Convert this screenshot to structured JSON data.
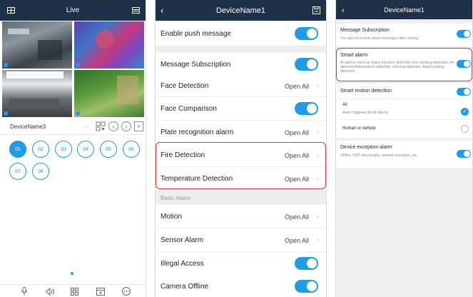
{
  "screen1": {
    "title": "Live",
    "device_name": "DeviceName3",
    "channels": [
      "01",
      "02",
      "03",
      "04",
      "05",
      "06",
      "07",
      "08"
    ],
    "selected_channel": "01"
  },
  "screen2": {
    "title": "DeviceName1",
    "enable_push": "Enable push message",
    "message_subscription": "Message Subscription",
    "face_detection": "Face Detection",
    "face_comparison": "Face Comparison",
    "plate_recognition": "Plate recognition alarm",
    "fire_detection": "Fire Detection",
    "temperature_detection": "Temperature Detection",
    "basic_alarm_header": "Basic Alarm",
    "motion": "Motion",
    "sensor_alarm": "Sensor Alarm",
    "illegal_access": "Illegal Access",
    "camera_offline": "Camera Offline",
    "open_all": "Open All"
  },
  "screen3": {
    "title": "DeviceName1",
    "message_subscription": "Message Subscription",
    "message_subscription_desc": "You will not receive alarm messages after closing",
    "smart_alarm": "Smart alarm",
    "smart_alarm_desc": "AI alarms, such as region intrusion detection, line crossing detection, fire detection/temperature detection, loitering detection, illegal parking detection,",
    "smart_motion": "Smart motion detection",
    "all_label": "All",
    "all_desc": "Alarm triggered by all objects",
    "human_vehicle": "Human or vehicle",
    "device_exception": "Device exception alarm",
    "device_exception_desc": "Offline, HDD abnormality, network exception, etc."
  },
  "colors": {
    "header": "#1f3149",
    "accent": "#1e9be9",
    "highlight": "#d7363a"
  }
}
